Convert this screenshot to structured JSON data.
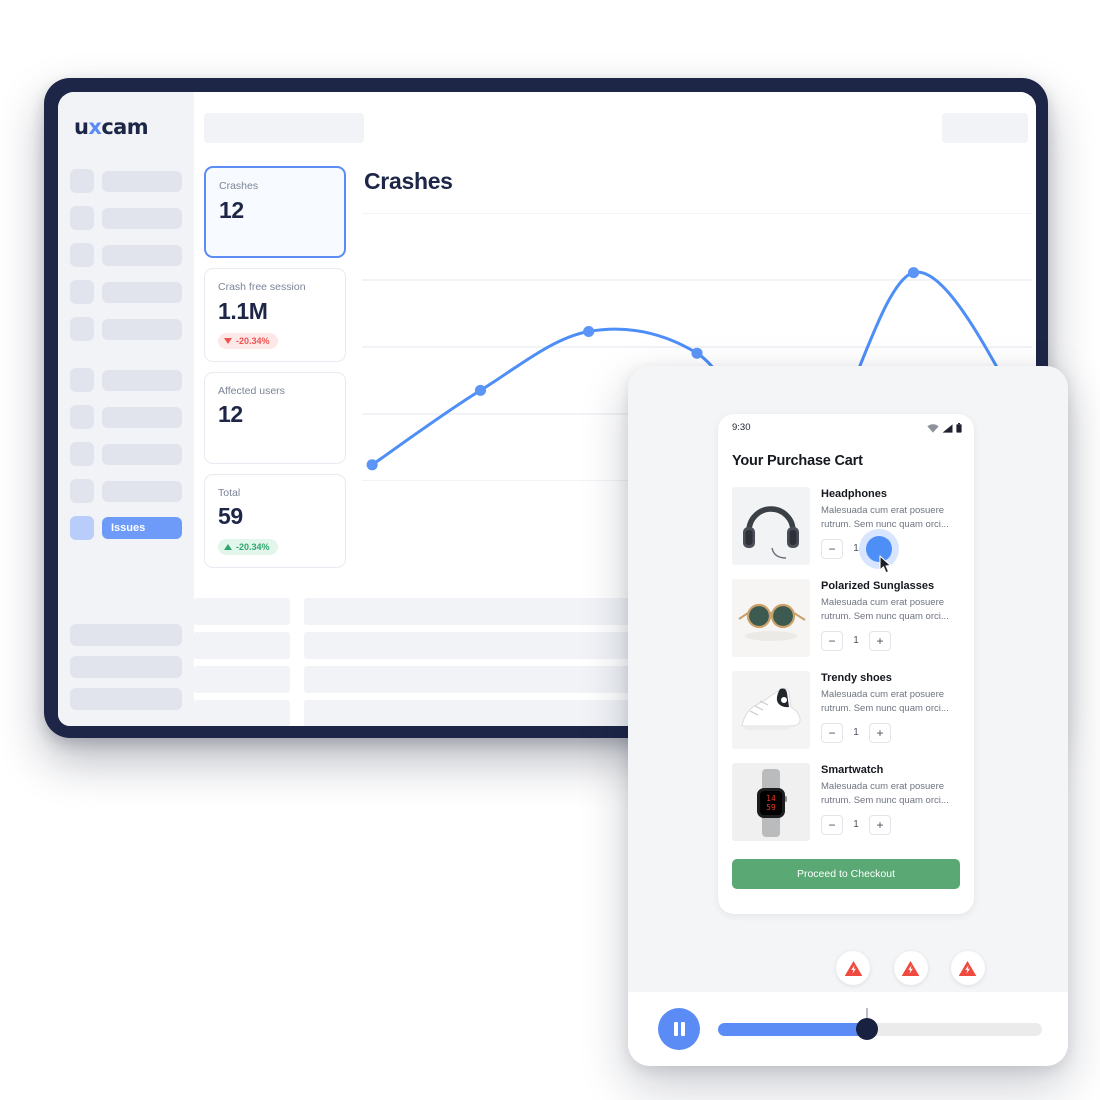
{
  "brand": {
    "name_part1": "u",
    "name_x": "x",
    "name_part2": "cam",
    "accent": "#5b8cf5",
    "dark": "#1e2647"
  },
  "sidebar": {
    "group1_count": 5,
    "group2_count": 4,
    "active_item": {
      "label": "Issues"
    },
    "bottom_count": 3
  },
  "topbar": {
    "left_skeleton": "",
    "right_skeleton": ""
  },
  "cards": [
    {
      "label": "Crashes",
      "value": "12",
      "selected": true,
      "badge": null
    },
    {
      "label": "Crash free session",
      "value": "1.1M",
      "selected": false,
      "badge": {
        "text": "-20.34%",
        "direction": "down",
        "color": "#ef5350"
      }
    },
    {
      "label": "Affected users",
      "value": "12",
      "selected": false,
      "badge": null
    },
    {
      "label": "Total",
      "value": "59",
      "selected": false,
      "badge": {
        "text": "-20.34%",
        "direction": "up",
        "color": "#2fa66f"
      }
    }
  ],
  "chart_data": {
    "type": "line",
    "title": "Crashes",
    "xlabel": "",
    "ylabel": "",
    "grid": true,
    "gridlines": 5,
    "legend": "none",
    "line_color": "#4d8ef7",
    "marker_color": "#5b95f7",
    "x": [
      0,
      1,
      2,
      3,
      4,
      5,
      6
    ],
    "values": [
      2,
      26,
      45,
      38,
      2,
      64,
      20
    ],
    "ylim": [
      0,
      80
    ],
    "series": [
      {
        "name": "Crashes",
        "values": [
          2,
          26,
          45,
          38,
          2,
          64,
          20
        ]
      }
    ]
  },
  "table": {
    "rows": 4,
    "columns": 3
  },
  "replay": {
    "phone": {
      "status": {
        "clock": "9:30",
        "wifi": "wifi-icon",
        "signal": "signal-icon",
        "battery": "battery-icon"
      },
      "title": "Your Purchase Cart",
      "items": [
        {
          "name": "Headphones",
          "desc": "Malesuada cum erat posuere rutrum. Sem nunc quam orci...",
          "qty": "1",
          "minus": "−",
          "plus": "+",
          "tapped": true
        },
        {
          "name": "Polarized Sunglasses",
          "desc": "Malesuada cum erat posuere rutrum. Sem nunc quam orci...",
          "qty": "1",
          "minus": "−",
          "plus": "+",
          "tapped": false
        },
        {
          "name": "Trendy shoes",
          "desc": "Malesuada cum erat posuere rutrum. Sem nunc quam orci...",
          "qty": "1",
          "minus": "−",
          "plus": "+",
          "tapped": false
        },
        {
          "name": "Smartwatch",
          "desc": "Malesuada cum erat posuere rutrum. Sem nunc quam orci...",
          "qty": "1",
          "minus": "−",
          "plus": "+",
          "tapped": false
        }
      ],
      "checkout_label": "Proceed to Checkout",
      "checkout_color": "#5aa874"
    },
    "player": {
      "play_state": "pause",
      "progress_percent": 46,
      "markers": [
        {
          "type": "crash-marker",
          "percent": 46
        },
        {
          "type": "crash-marker",
          "percent": 59
        },
        {
          "type": "crash-marker",
          "percent": 72
        }
      ],
      "marker_color": "#ef4a3d"
    }
  }
}
